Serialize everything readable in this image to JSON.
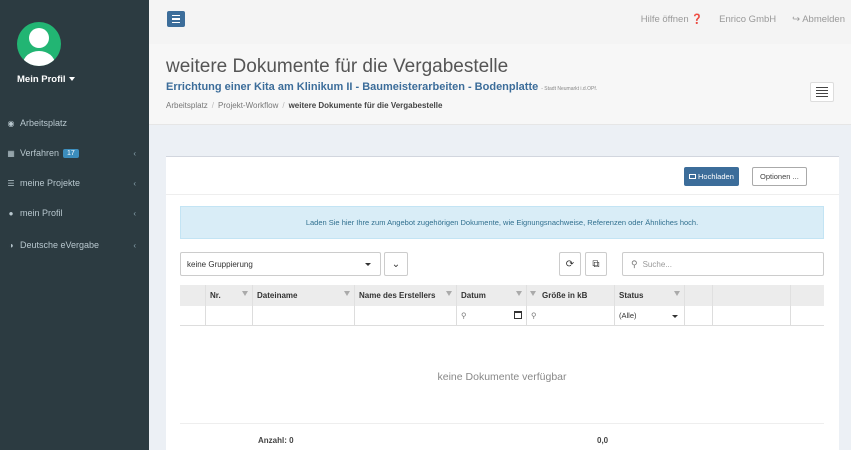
{
  "sidebar": {
    "profile_label": "Mein Profil",
    "items": [
      {
        "icon": "dashboard-icon",
        "label": "Arbeitsplatz",
        "badge": "",
        "chevron": false
      },
      {
        "icon": "grid-icon",
        "label": "Verfahren",
        "badge": "17",
        "chevron": true
      },
      {
        "icon": "list-icon",
        "label": "meine Projekte",
        "badge": "",
        "chevron": true
      },
      {
        "icon": "user-icon",
        "label": "mein Profil",
        "badge": "",
        "chevron": true
      },
      {
        "icon": "globe-icon",
        "label": "Deutsche eVergabe",
        "badge": "",
        "chevron": true
      }
    ]
  },
  "topbar": {
    "help_label": "Hilfe öffnen",
    "company": "Enrico GmbH",
    "logout_label": "Abmelden"
  },
  "header": {
    "title": "weitere Dokumente für die Vergabestelle",
    "subtitle": "Errichtung einer Kita am Klinikum II - Baumeisterarbeiten - Bodenplatte",
    "subtitle_small": "- Stadt Neumarkt i.d.OPf.",
    "breadcrumb": [
      "Arbeitsplatz",
      "Projekt-Workflow",
      "weitere Dokumente für die Vergabestelle"
    ]
  },
  "panel": {
    "upload_label": "Hochladen",
    "options_label": "Optionen ...",
    "info_text": "Laden Sie hier Ihre zum Angebot zugehörigen Dokumente, wie Eignungsnachweise, Referenzen oder Ähnliches hoch.",
    "grouping_value": "keine Gruppierung",
    "search_placeholder": "Suche..."
  },
  "grid": {
    "columns": [
      "Nr.",
      "Dateiname",
      "Name des Erstellers",
      "Datum",
      "Größe in kB",
      "Status"
    ],
    "status_filter": "(Alle)",
    "empty_text": "keine Dokumente verfügbar",
    "count_label": "Anzahl: 0",
    "sum_value": "0,0"
  },
  "colors": {
    "sidebar_bg": "#2c3b41",
    "accent": "#3c6d9a",
    "info_bg": "#d9edf7",
    "avatar": "#22b573"
  }
}
